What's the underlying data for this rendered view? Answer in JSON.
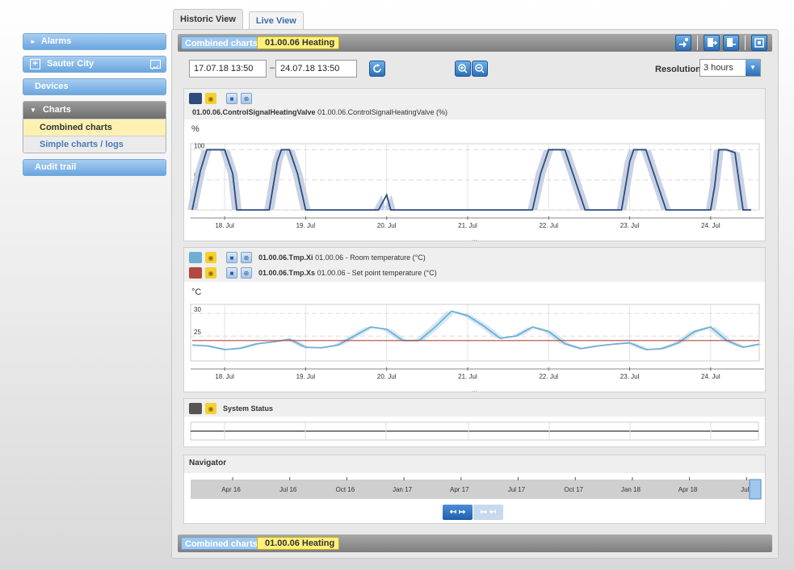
{
  "tabs": [
    {
      "label": "Historic View",
      "active": true
    },
    {
      "label": "Live View",
      "active": false
    }
  ],
  "sidebar": {
    "alarms": "Alarms",
    "sauter_city": "Sauter City",
    "devices": "Devices",
    "charts": "Charts",
    "charts_items": [
      "Combined charts",
      "Simple charts / logs"
    ],
    "audit_trail": "Audit trail"
  },
  "breadcrumb": {
    "item1": "Combined charts",
    "item2": "01.00.06 Heating"
  },
  "controls": {
    "date_from": "17.07.18 13:50",
    "date_to": "24.07.18 13:50",
    "separator": "–",
    "resolution_label": "Resolution",
    "resolution_value": "3 hours"
  },
  "chart1": {
    "series": [
      {
        "name_bold": "01.00.06.ControlSignalHeatingValve",
        "desc": "01.00.06.ControlSignalHeatingValve (%)",
        "color": "#2e4b7d"
      }
    ],
    "unit": "%"
  },
  "chart2": {
    "series": [
      {
        "name_bold": "01.00.06.Tmp.Xi",
        "desc": "01.00.06 - Room temperature (°C)",
        "color": "#6faed3"
      },
      {
        "name_bold": "01.00.06.Tmp.Xs",
        "desc": "01.00.06 - Set point temperature (°C)",
        "color": "#b3483e"
      }
    ],
    "unit": "°C"
  },
  "chart3": {
    "series": [
      {
        "name_bold": "System Status",
        "color": "#555555"
      }
    ]
  },
  "navigator": {
    "title": "Navigator",
    "ticks": [
      "Apr 16",
      "Jul 16",
      "Oct 16",
      "Jan 17",
      "Apr 17",
      "Jul 17",
      "Oct 17",
      "Jan 18",
      "Apr 18",
      "Jul"
    ]
  },
  "chart_data": [
    {
      "type": "area",
      "title": "",
      "ylabel": "%",
      "ylim": [
        0,
        110
      ],
      "yticks": [
        0,
        50,
        100
      ],
      "x_tick_labels": [
        "18. Jul",
        "19. Jul",
        "20. Jul",
        "21. Jul",
        "22. Jul",
        "23. Jul",
        "24. Jul"
      ],
      "x": [
        17.6,
        17.7,
        17.78,
        17.85,
        17.93,
        18.0,
        18.1,
        18.15,
        18.25,
        18.35,
        18.45,
        18.5,
        18.55,
        18.65,
        18.7,
        18.8,
        18.9,
        19.0,
        19.05,
        19.1,
        19.2,
        19.3,
        19.4,
        19.5,
        19.6,
        19.7,
        19.8,
        19.9,
        20.0,
        20.05,
        20.1,
        20.15,
        20.2,
        20.3,
        20.4,
        20.5,
        20.6,
        20.8,
        21.0,
        21.2,
        21.4,
        21.6,
        21.7,
        21.8,
        21.9,
        22.0,
        22.05,
        22.1,
        22.2,
        22.3,
        22.45,
        22.6,
        22.7,
        22.8,
        22.9,
        23.0,
        23.05,
        23.1,
        23.2,
        23.3,
        23.45,
        23.6,
        23.7,
        23.8,
        23.9,
        24.0,
        24.05,
        24.1,
        24.2,
        24.3,
        24.4,
        24.5
      ],
      "series": [
        {
          "name": "01.00.06.ControlSignalHeatingValve",
          "values": [
            0,
            65,
            100,
            100,
            100,
            100,
            60,
            0,
            0,
            0,
            0,
            0,
            0,
            80,
            100,
            100,
            60,
            0,
            0,
            0,
            0,
            0,
            0,
            0,
            0,
            0,
            0,
            0,
            25,
            0,
            0,
            0,
            0,
            0,
            0,
            0,
            0,
            0,
            0,
            0,
            0,
            0,
            0,
            0,
            60,
            100,
            100,
            100,
            100,
            60,
            0,
            0,
            0,
            0,
            0,
            80,
            100,
            100,
            100,
            60,
            0,
            0,
            0,
            0,
            0,
            0,
            40,
            100,
            100,
            95,
            0,
            0
          ]
        }
      ]
    },
    {
      "type": "line",
      "title": "",
      "ylabel": "°C",
      "ylim": [
        19.5,
        32
      ],
      "yticks": [
        25,
        30
      ],
      "x_tick_labels": [
        "18. Jul",
        "19. Jul",
        "20. Jul",
        "21. Jul",
        "22. Jul",
        "23. Jul",
        "24. Jul"
      ],
      "x": [
        17.6,
        17.8,
        18.0,
        18.2,
        18.4,
        18.6,
        18.8,
        19.0,
        19.2,
        19.4,
        19.6,
        19.8,
        20.0,
        20.2,
        20.4,
        20.6,
        20.8,
        21.0,
        21.2,
        21.4,
        21.6,
        21.8,
        22.0,
        22.2,
        22.4,
        22.6,
        22.8,
        23.0,
        23.2,
        23.4,
        23.6,
        23.8,
        24.0,
        24.2,
        24.4,
        24.6
      ],
      "series": [
        {
          "name": "01.00.06.Tmp.Xi",
          "values": [
            23.0,
            22.8,
            22.0,
            22.3,
            23.3,
            23.7,
            24.3,
            22.5,
            22.4,
            23.0,
            25.0,
            27.0,
            26.5,
            24.0,
            24.0,
            27.0,
            30.5,
            29.5,
            27.2,
            24.5,
            25.0,
            27.0,
            26.0,
            23.3,
            22.2,
            22.8,
            23.2,
            23.5,
            22.0,
            22.2,
            23.5,
            26.0,
            27.0,
            24.0,
            22.5,
            23.2
          ]
        },
        {
          "name": "01.00.06.Tmp.Xs",
          "values": [
            24.0,
            24.0,
            24.0,
            24.0,
            24.0,
            24.0,
            24.0,
            24.0,
            24.0,
            24.0,
            24.0,
            24.0,
            24.0,
            24.0,
            24.0,
            24.0,
            24.0,
            24.0,
            24.0,
            24.0,
            24.0,
            24.0,
            24.0,
            24.0,
            24.0,
            24.0,
            24.0,
            24.0,
            24.0,
            24.0,
            24.0,
            24.0,
            24.0,
            24.0,
            24.0,
            24.0
          ]
        }
      ]
    }
  ]
}
